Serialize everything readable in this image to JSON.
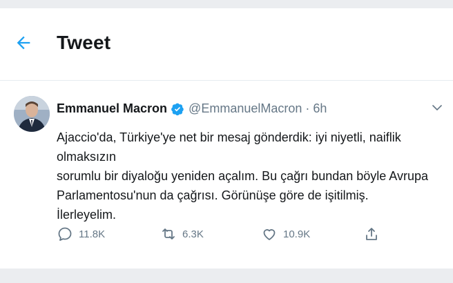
{
  "header": {
    "title": "Tweet",
    "back_icon": "arrow-left-icon"
  },
  "tweet": {
    "author_name": "Emmanuel Macron",
    "verified": true,
    "handle": "@EmmanuelMacron",
    "separator": "·",
    "time": "6h",
    "lines": [
      "Ajaccio'da, Türkiye'ye net bir mesaj gönderdik: iyi niyetli, naiflik olmaksızın",
      "sorumlu bir diyaloğu yeniden açalım. Bu çağrı bundan böyle Avrupa",
      "Parlamentosu'nun da çağrısı. Görünüşe göre de işitilmiş. İlerleyelim."
    ],
    "replies": "11.8K",
    "retweets": "6.3K",
    "likes": "10.9K"
  },
  "colors": {
    "accent": "#1da1f2",
    "text": "#14171a",
    "secondary": "#657786",
    "border": "#e6ecf0"
  }
}
